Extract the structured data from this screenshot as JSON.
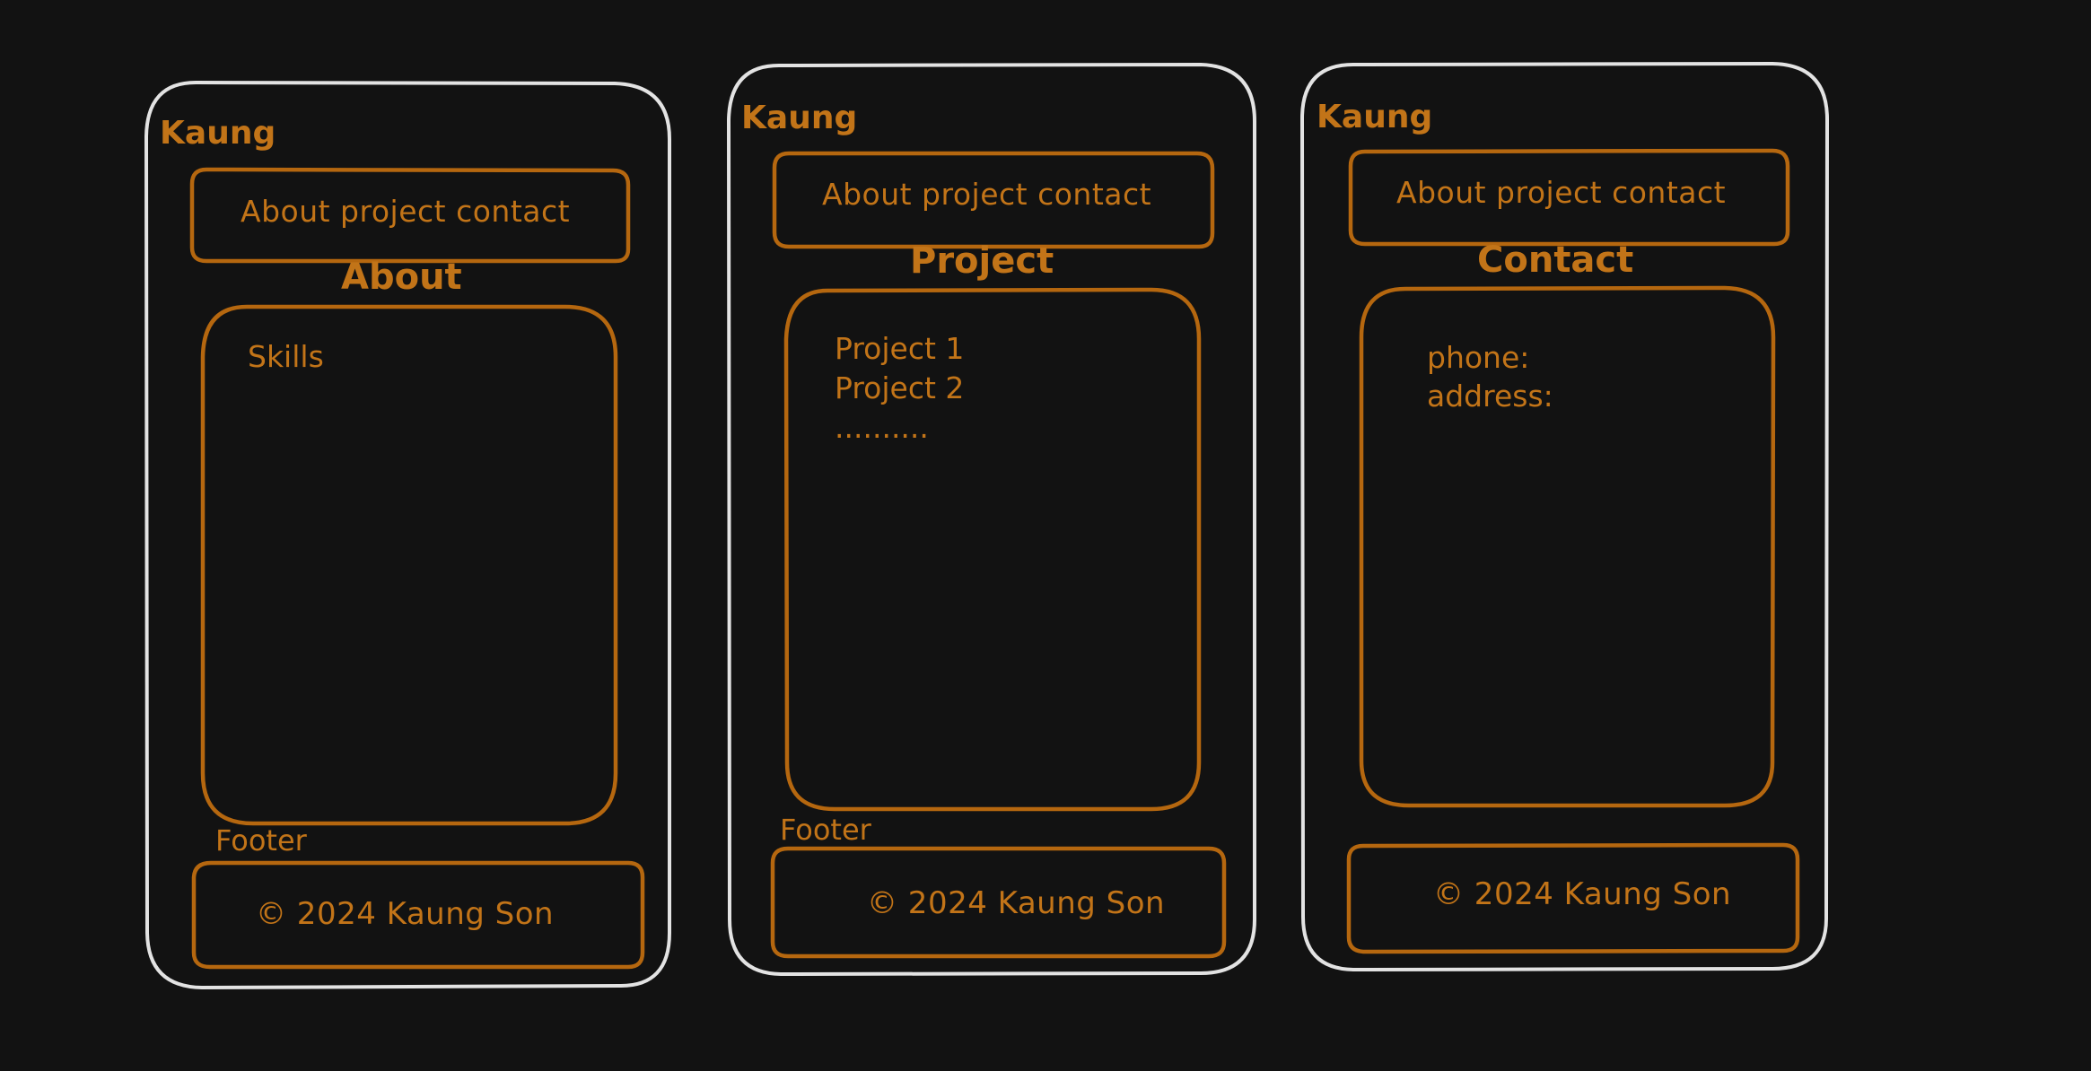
{
  "colors": {
    "background": "#121212",
    "frame": "#e3e3e3",
    "accent": "#b5670f",
    "text": "#c27418"
  },
  "screens": [
    {
      "brand": "Kaung",
      "nav_label": "About project contact",
      "section_title": "About",
      "content": [
        "Skills"
      ],
      "footer_label": "Footer",
      "footer_text": "© 2024 Kaung Son"
    },
    {
      "brand": "Kaung",
      "nav_label": "About project contact",
      "section_title": "Project",
      "content": [
        "Project 1",
        "Project 2",
        ".........."
      ],
      "footer_label": "Footer",
      "footer_text": "© 2024 Kaung Son"
    },
    {
      "brand": "Kaung",
      "nav_label": "About project contact",
      "section_title": "Contact",
      "content": [
        "phone:",
        "address:"
      ],
      "footer_text": "© 2024 Kaung Son"
    }
  ]
}
